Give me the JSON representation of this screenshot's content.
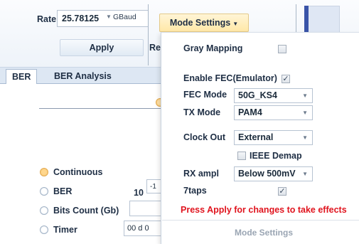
{
  "toolbar": {
    "rate_label": "Rate",
    "rate_value": "25.78125",
    "rate_unit": "GBaud",
    "apply_label": "Apply",
    "re_label": "Re",
    "mode_settings_label": "Mode Settings"
  },
  "tabs": [
    {
      "label": "BER"
    },
    {
      "label": "BER Analysis"
    }
  ],
  "ber_panel": {
    "continuous_label": "Continuous",
    "ber_label": "BER",
    "ber_base": "10",
    "ber_exponent": "-1",
    "bits_count_label": "Bits Count (Gb)",
    "timer_label": "Timer",
    "timer_value": "00 d 0"
  },
  "mode_settings": {
    "gray_mapping_label": "Gray Mapping",
    "gray_mapping_checked": false,
    "enable_fec_label": "Enable FEC(Emulator)",
    "enable_fec_checked": true,
    "fec_mode_label": "FEC Mode",
    "fec_mode_value": "50G_KS4",
    "tx_mode_label": "TX Mode",
    "tx_mode_value": "PAM4",
    "clock_out_label": "Clock Out",
    "clock_out_value": "External",
    "ieee_demap_label": "IEEE Demap",
    "ieee_demap_checked": false,
    "rx_ampl_label": "RX ampl",
    "rx_ampl_value": "Below 500mV",
    "taps_label": "7taps",
    "taps_checked": true,
    "warning": "Press Apply for changes to take effects",
    "footer_label": "Mode Settings"
  },
  "colors": {
    "accent_button": "#ffe8a8",
    "warning_text": "#e0141e",
    "tab_strip": "#dde7f3"
  },
  "icons": {
    "dropdown": "chevron-down-icon",
    "checkmark": "checkmark-icon"
  }
}
